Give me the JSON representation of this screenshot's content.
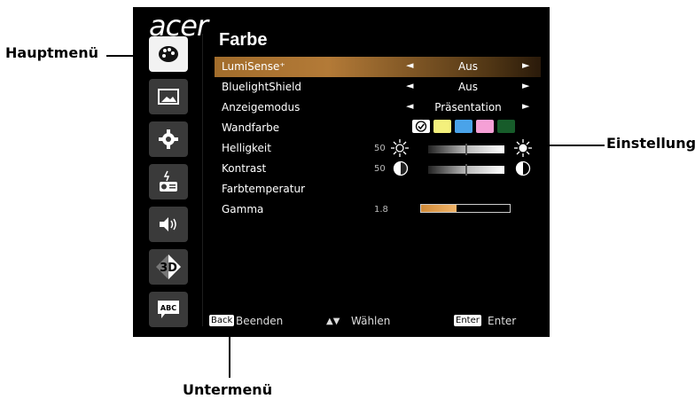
{
  "callouts": {
    "main_menu": "Hauptmenü",
    "setting": "Einstellung",
    "sub_menu": "Untermenü"
  },
  "osd": {
    "brand": "acer",
    "title": "Farbe",
    "sidebar": [
      {
        "icon": "palette-icon",
        "active": true
      },
      {
        "icon": "image-icon",
        "active": false
      },
      {
        "icon": "gear-icon",
        "active": false
      },
      {
        "icon": "projector-management-icon",
        "active": false
      },
      {
        "icon": "speaker-icon",
        "active": false
      },
      {
        "icon": "3d-icon",
        "active": false,
        "text": "3D"
      },
      {
        "icon": "language-icon",
        "active": false,
        "text": "ABC"
      }
    ],
    "menu": [
      {
        "label": "LumiSense⁺",
        "value": "Aus",
        "highlight": true
      },
      {
        "label": "BluelightShield",
        "value": "Aus"
      },
      {
        "label": "Anzeigemodus",
        "value": "Präsentation"
      },
      {
        "label": "Wandfarbe"
      },
      {
        "label": "Helligkeit",
        "number": "50"
      },
      {
        "label": "Kontrast",
        "number": "50"
      },
      {
        "label": "Farbtemperatur"
      },
      {
        "label": "Gamma",
        "number": "1.8"
      }
    ],
    "arrows": {
      "left": "◄",
      "right": "►"
    },
    "wall_colors": [
      "#ffffff",
      "#f4f07c",
      "#4aa3e9",
      "#f5a0d6",
      "#175c2a"
    ],
    "gamma_level": 0.4,
    "footer": {
      "back_key": "Back",
      "back_label": "Beenden",
      "select_keys": "▲▼",
      "select_label": "Wählen",
      "enter_key": "Enter",
      "enter_label": "Enter"
    }
  }
}
